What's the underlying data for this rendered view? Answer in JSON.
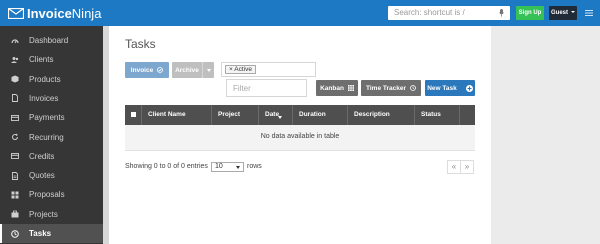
{
  "brand": {
    "name_bold": "Invoice",
    "name_light": "Ninja"
  },
  "search": {
    "placeholder": "Search: shortcut is /"
  },
  "header": {
    "signup_label": "Sign Up",
    "guest_label": "Guest"
  },
  "sidebar": {
    "items": [
      {
        "label": "Dashboard",
        "icon": "dashboard-icon"
      },
      {
        "label": "Clients",
        "icon": "users-icon"
      },
      {
        "label": "Products",
        "icon": "cube-icon"
      },
      {
        "label": "Invoices",
        "icon": "file-icon"
      },
      {
        "label": "Payments",
        "icon": "credit-card-icon"
      },
      {
        "label": "Recurring",
        "icon": "refresh-icon"
      },
      {
        "label": "Credits",
        "icon": "credit-card-icon"
      },
      {
        "label": "Quotes",
        "icon": "file-text-icon"
      },
      {
        "label": "Proposals",
        "icon": "th-large-icon"
      },
      {
        "label": "Projects",
        "icon": "briefcase-icon"
      },
      {
        "label": "Tasks",
        "icon": "clock-icon",
        "active": true
      }
    ]
  },
  "page": {
    "title": "Tasks"
  },
  "toolbar": {
    "invoice_label": "Invoice",
    "archive_label": "Archive",
    "status_tag": "× Active",
    "filter_placeholder": "Filter",
    "kanban_label": "Kanban",
    "time_tracker_label": "Time Tracker",
    "new_task_label": "New Task"
  },
  "table": {
    "columns": [
      "Client Name",
      "Project",
      "Date",
      "Duration",
      "Description",
      "Status"
    ],
    "empty_message": "No data available in table"
  },
  "footer": {
    "showing_text": "Showing 0 to 0 of 0 entries",
    "page_size": "10",
    "rows_label": "rows",
    "prev_label": "«",
    "next_label": "»"
  },
  "colors": {
    "topbar": "#1d79c3",
    "sidebar": "#363636",
    "signup": "#36c157",
    "new_task": "#2c78bd",
    "table_header": "#4f4f4f"
  }
}
